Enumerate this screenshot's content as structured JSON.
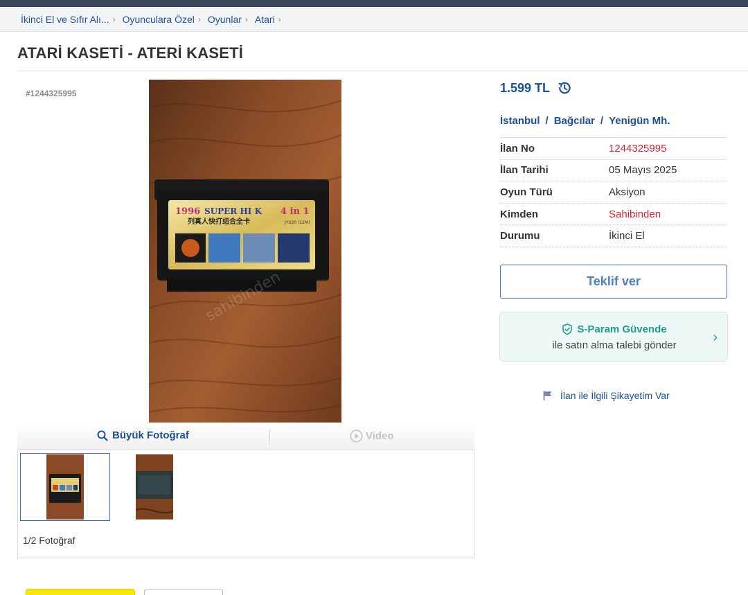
{
  "breadcrumb": [
    {
      "label": "İkinci El ve Sıfır Alı..."
    },
    {
      "label": "Oyunculara Özel"
    },
    {
      "label": "Oyunlar"
    },
    {
      "label": "Atari"
    }
  ],
  "breadcrumb_separator": "›",
  "listing": {
    "title": "ATARİ KASETİ - ATERİ KASETİ",
    "id_label": "#1244325995"
  },
  "photos": {
    "big_photo_label": "Büyük Fotoğraf",
    "video_label": "Video",
    "count_label": "1/2 Fotoğraf",
    "cartridge_label": {
      "year": "1996",
      "brand": "SUPER HI K",
      "count": "4 in 1",
      "subtitle": "列真人快打组合全卡",
      "model": "JY030 (12M)",
      "watermark": "sahibinden"
    }
  },
  "price": {
    "value": "1.599 TL"
  },
  "location": {
    "city": "İstanbul",
    "district": "Bağcılar",
    "neighborhood": "Yenigün Mh.",
    "separator": "/"
  },
  "details": [
    {
      "label": "İlan No",
      "value": "1244325995",
      "highlight": true
    },
    {
      "label": "İlan Tarihi",
      "value": "05 Mayıs 2025",
      "highlight": false
    },
    {
      "label": "Oyun Türü",
      "value": "Aksiyon",
      "highlight": false
    },
    {
      "label": "Kimden",
      "value": "Sahibinden",
      "highlight": true
    },
    {
      "label": "Durumu",
      "value": "İkinci El",
      "highlight": false
    }
  ],
  "actions": {
    "offer_label": "Teklif ver",
    "sparam_title": "S-Param Güvende",
    "sparam_subtitle": "ile satın alma talebi gönder",
    "complaint_label": "İlan ile İlgili Şikayetim Var"
  },
  "colors": {
    "link_blue": "#1d4fa0",
    "highlight_red": "#d3262f",
    "sparam_green": "#1f9a8f",
    "topbar": "#3b4458",
    "yellow_button": "#ffe800"
  },
  "icons": [
    "search-icon",
    "play-circle-icon",
    "history-icon",
    "shield-check-icon",
    "chevron-right-icon",
    "flag-icon"
  ]
}
